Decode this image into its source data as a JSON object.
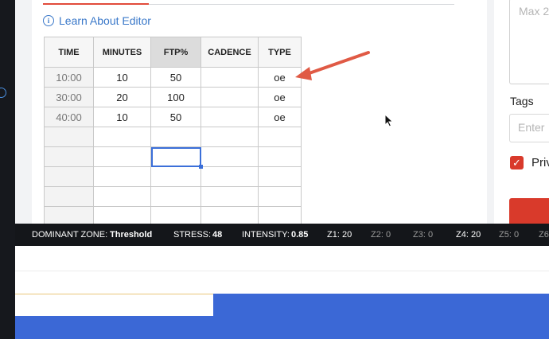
{
  "editor": {
    "learn_link": "Learn About Editor",
    "table": {
      "headers": [
        "TIME",
        "MINUTES",
        "FTP%",
        "CADENCE",
        "TYPE"
      ],
      "rows": [
        [
          "10:00",
          "10",
          "50",
          "",
          "oe"
        ],
        [
          "30:00",
          "20",
          "100",
          "",
          "oe"
        ],
        [
          "40:00",
          "10",
          "50",
          "",
          "oe"
        ],
        [
          "",
          "",
          "",
          "",
          ""
        ],
        [
          "",
          "",
          "",
          "",
          ""
        ],
        [
          "",
          "",
          "",
          "",
          ""
        ],
        [
          "",
          "",
          "",
          "",
          ""
        ],
        [
          "",
          "",
          "",
          "",
          ""
        ]
      ]
    }
  },
  "sidebar": {
    "textarea_placeholder": "Max 2",
    "tags_label": "Tags",
    "tags_placeholder": "Enter",
    "private_label": "Priv"
  },
  "status": {
    "dominant_zone_label": "DOMINANT ZONE:",
    "dominant_zone_value": "Threshold",
    "stress_label": "STRESS:",
    "stress_value": "48",
    "intensity_label": "INTENSITY:",
    "intensity_value": "0.85",
    "z1": "Z1: 20",
    "z2": "Z2: 0",
    "z3": "Z3: 0",
    "z4": "Z4: 20",
    "z5": "Z5: 0",
    "z6": "Z6"
  },
  "colors": {
    "accent_red": "#d93a2b",
    "link_blue": "#3a78c9",
    "selection_blue": "#3b6fd9",
    "footer_blue": "#3b68d6"
  }
}
